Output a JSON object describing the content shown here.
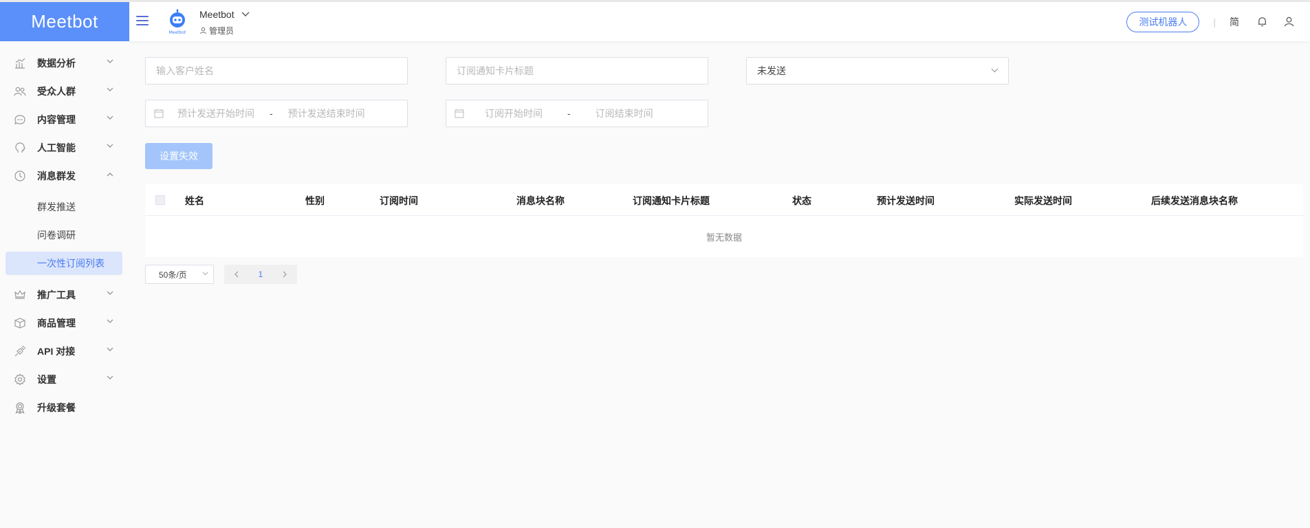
{
  "header": {
    "logo_text": "Meetbot",
    "bot_name": "Meetbot",
    "bot_avatar_caption": "Meetbot",
    "bot_role": "管理员",
    "test_bot_label": "测试机器人",
    "language_label": "简",
    "accent_color": "#5b8ff9"
  },
  "sidebar": {
    "items": [
      {
        "label": "数据分析",
        "icon": "chart-icon"
      },
      {
        "label": "受众人群",
        "icon": "users-icon"
      },
      {
        "label": "内容管理",
        "icon": "chat-icon"
      },
      {
        "label": "人工智能",
        "icon": "head-icon"
      },
      {
        "label": "消息群发",
        "icon": "clock-icon",
        "expanded": true
      },
      {
        "label": "推广工具",
        "icon": "crown-icon"
      },
      {
        "label": "商品管理",
        "icon": "box-icon"
      },
      {
        "label": "API 对接",
        "icon": "plug-icon"
      },
      {
        "label": "设置",
        "icon": "gear-icon"
      },
      {
        "label": "升级套餐",
        "icon": "badge-icon"
      }
    ],
    "sub_items": [
      {
        "label": "群发推送",
        "active": false
      },
      {
        "label": "问卷调研",
        "active": false
      },
      {
        "label": "一次性订阅列表",
        "active": true
      }
    ]
  },
  "filters": {
    "customer_name_placeholder": "输入客户姓名",
    "card_title_placeholder": "订阅通知卡片标题",
    "status_value": "未发送",
    "plan_start_placeholder": "预计发送开始时间",
    "plan_end_placeholder": "预计发送结束时间",
    "sub_start_placeholder": "订阅开始时间",
    "sub_end_placeholder": "订阅结束时间",
    "range_separator": "-"
  },
  "actions": {
    "set_invalid_label": "设置失效"
  },
  "table": {
    "columns": [
      "姓名",
      "性别",
      "订阅时间",
      "消息块名称",
      "订阅通知卡片标题",
      "状态",
      "预计发送时间",
      "实际发送时间",
      "后续发送消息块名称"
    ],
    "empty_text": "暂无数据"
  },
  "pagination": {
    "page_size": "50条/页",
    "current_page": "1"
  }
}
